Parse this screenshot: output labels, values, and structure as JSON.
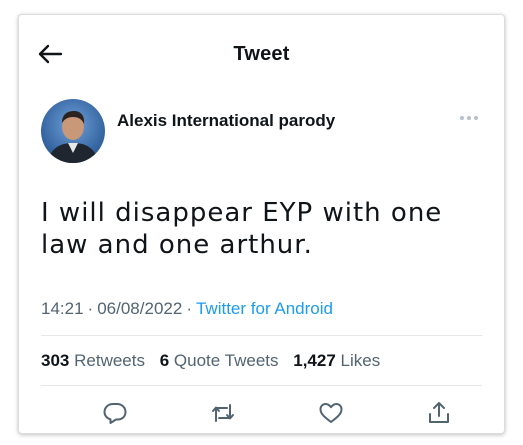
{
  "header": {
    "title": "Tweet",
    "back_icon": "arrow-left-icon"
  },
  "tweet": {
    "author_name": "Alexis International parody",
    "more_icon": "more-dots-icon",
    "text": "I will disappear EYP with one law and one arthur.",
    "time": "14:21",
    "separator": "·",
    "date": "06/08/2022",
    "source": "Twitter for Android"
  },
  "stats": {
    "retweets_count": "303",
    "retweets_label": "Retweets",
    "quotes_count": "6",
    "quotes_label": "Quote Tweets",
    "likes_count": "1,427",
    "likes_label": "Likes"
  },
  "actions": {
    "reply_icon": "reply-icon",
    "retweet_icon": "retweet-icon",
    "like_icon": "heart-icon",
    "share_icon": "share-icon"
  },
  "colors": {
    "text": "#0f1419",
    "secondary": "#536471",
    "link": "#1d9bf0",
    "divider": "#e5e8ea"
  }
}
